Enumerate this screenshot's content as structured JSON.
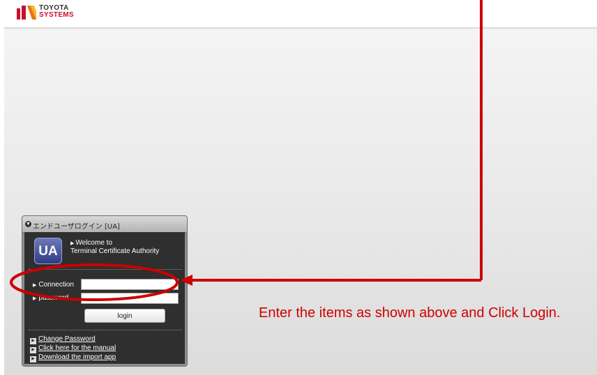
{
  "header": {
    "logo_line1": "TOYOTA",
    "logo_line2": "SYSTEMS",
    "logo_colors": [
      "#c8102e",
      "#e8741c",
      "#f3b21b"
    ]
  },
  "panel": {
    "title": "エンドユーザログイン [UA]",
    "badge": "UA",
    "welcome_line1": "Welcome to",
    "welcome_line2": "Terminal Certificate Authority",
    "connection_label": "Connection",
    "connection_value": "",
    "password_label": "password",
    "password_value": "",
    "login_label": "login",
    "links": [
      "Change Password",
      "Click here for the manual",
      "Download the import app"
    ]
  },
  "annotation": {
    "instruction": "Enter the items as shown above and Click Login.",
    "color": "#cc0000"
  }
}
